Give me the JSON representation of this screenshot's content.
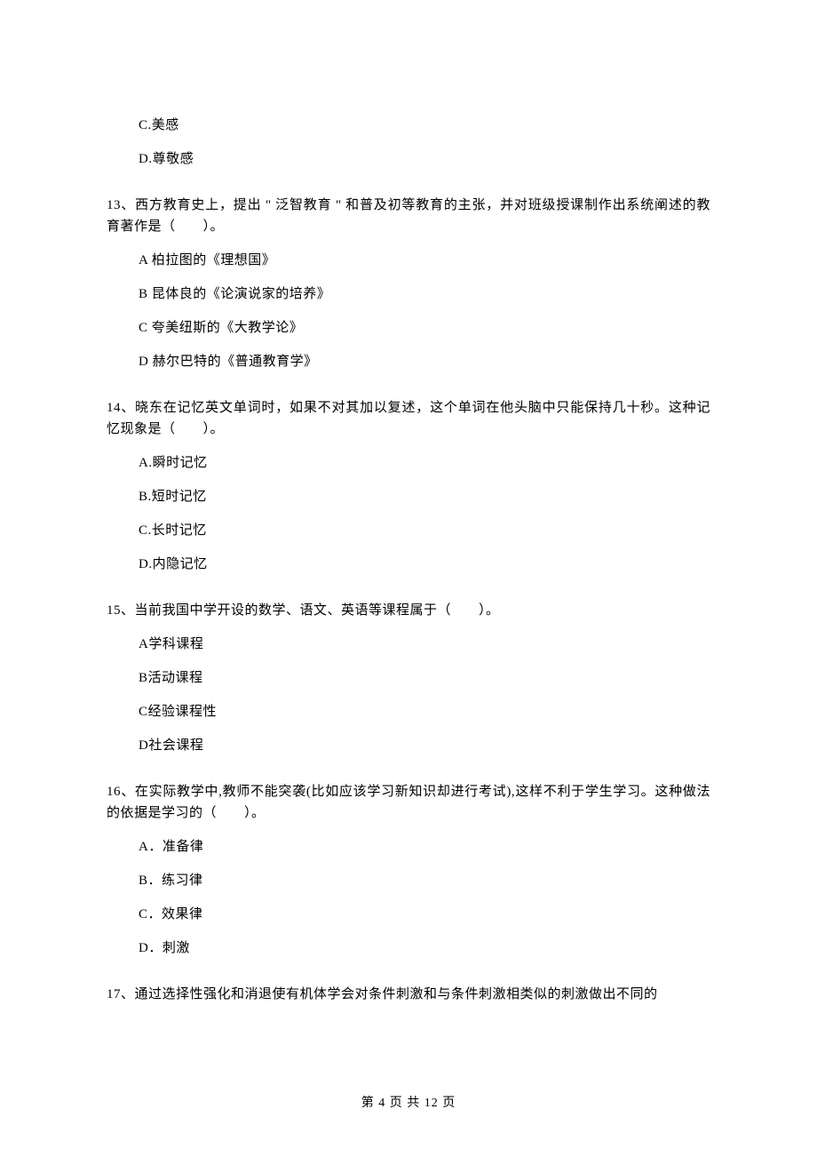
{
  "options_pre": [
    "C.美感",
    "D.尊敬感"
  ],
  "q13": {
    "text": "13、西方教育史上，提出 \" 泛智教育 \" 和普及初等教育的主张，并对班级授课制作出系统阐述的教育著作是（　　）。",
    "options": [
      "A 柏拉图的《理想国》",
      "B 昆体良的《论演说家的培养》",
      "C 夸美纽斯的《大教学论》",
      "D 赫尔巴特的《普通教育学》"
    ]
  },
  "q14": {
    "text": "14、晓东在记忆英文单词时，如果不对其加以复述，这个单词在他头脑中只能保持几十秒。这种记忆现象是（　　）。",
    "options": [
      "A.瞬时记忆",
      "B.短时记忆",
      "C.长时记忆",
      "D.内隐记忆"
    ]
  },
  "q15": {
    "text": "15、当前我国中学开设的数学、语文、英语等课程属于（　　）。",
    "options": [
      "A学科课程",
      "B活动课程",
      "C经验课程性",
      "D社会课程"
    ]
  },
  "q16": {
    "text": "16、在实际教学中,教师不能突袭(比如应该学习新知识却进行考试),这样不利于学生学习。这种做法的依据是学习的（　　）。",
    "options": [
      "A．准备律",
      "B．练习律",
      "C．效果律",
      "D．刺激"
    ]
  },
  "q17": {
    "text": "17、通过选择性强化和消退使有机体学会对条件刺激和与条件刺激相类似的刺激做出不同的"
  },
  "footer": "第 4 页 共 12 页"
}
